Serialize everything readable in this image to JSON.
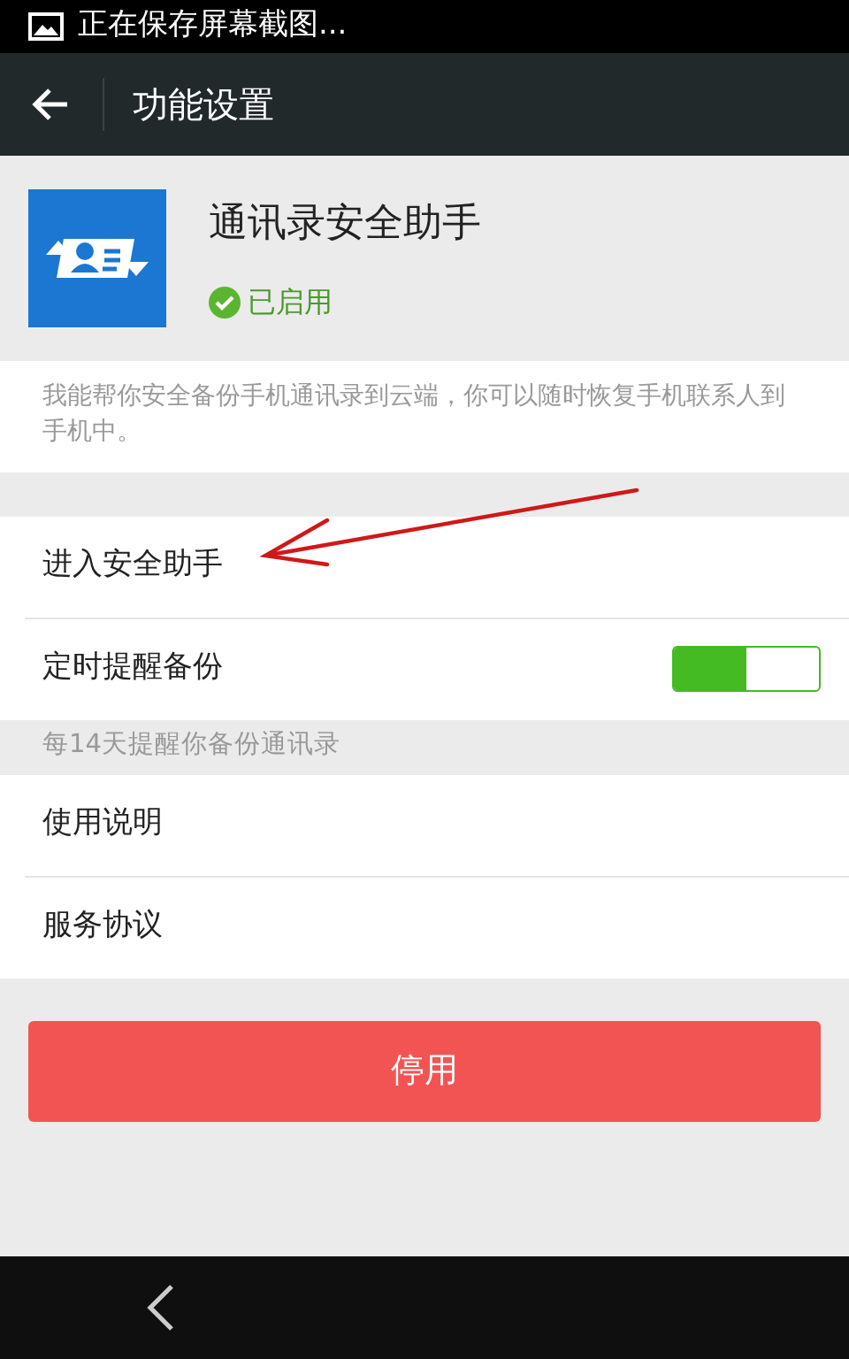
{
  "status_bar": {
    "notification": "正在保存屏幕截图..."
  },
  "header": {
    "title": "功能设置"
  },
  "app": {
    "name": "通讯录安全助手",
    "status": "已启用",
    "enabled": true
  },
  "description": "我能帮你安全备份手机通讯录到云端，你可以随时恢复手机联系人到手机中。",
  "groups": [
    {
      "items": [
        {
          "kind": "link",
          "label": "进入安全助手"
        },
        {
          "kind": "switch",
          "label": "定时提醒备份",
          "on": true
        }
      ],
      "footer": "每14天提醒你备份通讯录"
    },
    {
      "items": [
        {
          "kind": "link",
          "label": "使用说明"
        },
        {
          "kind": "link",
          "label": "服务协议"
        }
      ]
    }
  ],
  "disable_button": "停用"
}
